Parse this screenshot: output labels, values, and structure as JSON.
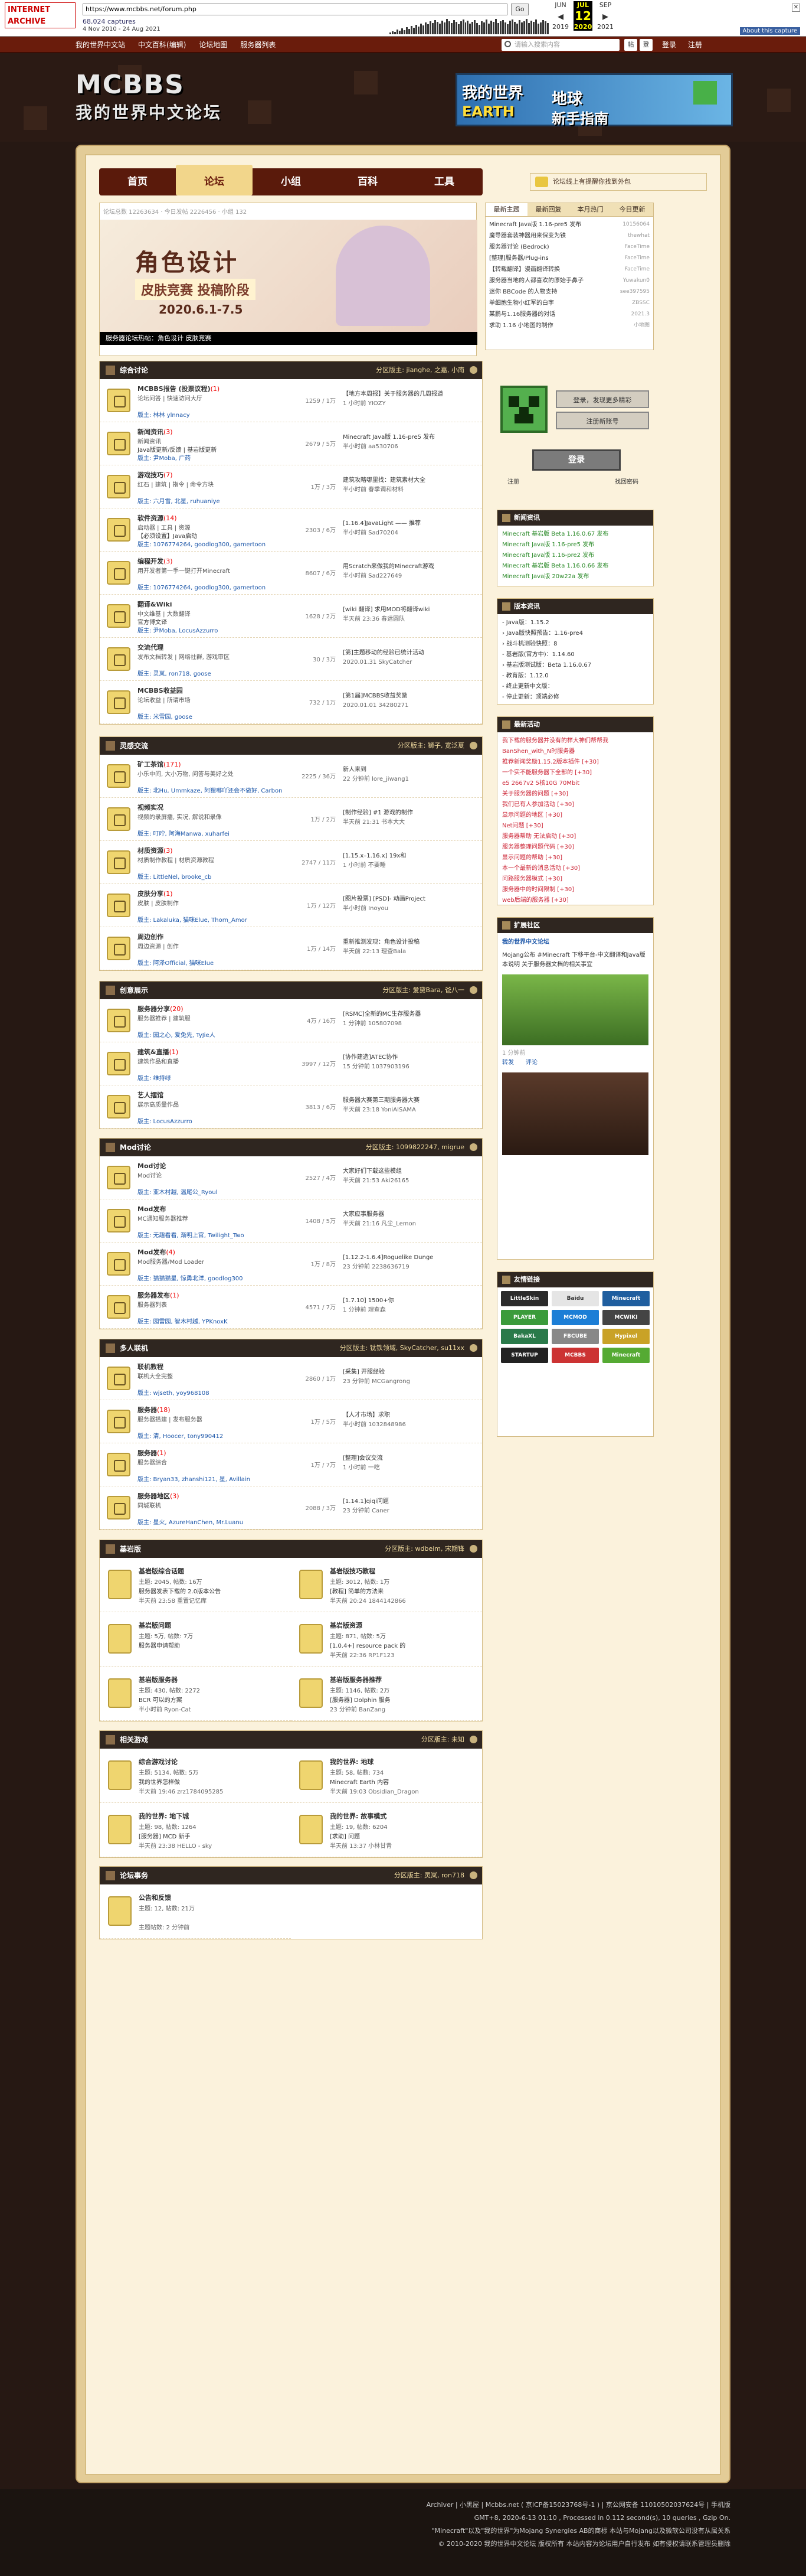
{
  "wayback": {
    "url": "https://www.mcbbs.net/forum.php",
    "go": "Go",
    "captures": "68,024 captures",
    "range": "4 Nov 2010 - 24 Aug 2021",
    "months": [
      "JUN",
      "JUL",
      "SEP"
    ],
    "day": "12",
    "years": [
      "2019",
      "2020",
      "2021"
    ],
    "about": "About this capture",
    "logo": "INTERNET ARCHIVE"
  },
  "topbar": {
    "nav": [
      "我的世界中文站",
      "中文百科(编辑)",
      "论坛地图",
      "服务器列表"
    ],
    "search_placeholder": "请输入搜索内容",
    "btn1": "帖",
    "btn2": "登",
    "login": "登录",
    "register": "注册"
  },
  "header": {
    "logo_en": "MCBBS",
    "logo_cn": "我的世界中文论坛",
    "ad_title1": "我的世界",
    "ad_title2": "EARTH",
    "ad_title3": "地球",
    "ad_title4": "新手指南"
  },
  "mainnav": [
    "首页",
    "论坛",
    "小组",
    "百科",
    "工具"
  ],
  "notice": "论坛线上有提醒你找到外包",
  "slide": {
    "breadcrumb": "论坛总数 12263634 · 今日发帖 2226456 · 小组 132",
    "h1": "角色设计",
    "h2": "皮肤竞赛 投稿阶段",
    "h3": "2020.6.1-7.5",
    "caption": "服务器论坛热帖：角色设计 皮肤竞赛"
  },
  "hot": {
    "tabs": [
      "最新主题",
      "最新回复",
      "本月热门",
      "今日更新"
    ],
    "items": [
      [
        "Minecraft Java版 1.16-pre5 发布",
        "10156064"
      ],
      [
        "魔导器套装神器用来保变为铁",
        "thewhat"
      ],
      [
        "服务器讨论 (Bedrock)",
        "FaceTime"
      ],
      [
        "[整理]服务器/Plug-ins",
        "FaceTime"
      ],
      [
        "【转载翻译】漫画翻译转换",
        "FaceTime"
      ],
      [
        "服务器当地的人都喜欢的原始手鼻子",
        "Yuwakun0"
      ],
      [
        "迷你 BBCode 的人物支持",
        "see397595"
      ],
      [
        "单细胞生物小红军的白字",
        "ZBSSC"
      ],
      [
        "某鹏与1.16服务器的对话",
        "2021.3"
      ],
      [
        "求助 1.16 小地图的制作",
        "小地图"
      ]
    ]
  },
  "sections": [
    {
      "title": "综合讨论",
      "mods": "分区版主: jianghe, 之嘉, 小南",
      "rows": [
        {
          "name": "MCBBS报告 (投票议程)",
          "new": "(1)",
          "d1": "论坛问答 | 快速访问大厅",
          "d2": "",
          "d3": "版主: 林林 ylnnacy",
          "count": "1259 / 1万",
          "lp": "【地方本周报】关于服务器的几周报道",
          "lt": "1 小时前 YIOZY"
        },
        {
          "name": "新闻资讯",
          "new": "(3)",
          "d1": "新闻资讯",
          "d2": "Java版更新/反馈 | 基岩版更新",
          "d3": "版主: 尹Moba, 广药",
          "count": "2679 / 5万",
          "lp": "Minecraft Java版 1.16-pre5 发布",
          "lt": "半小时前 aa530706"
        },
        {
          "name": "游戏技巧",
          "new": "(7)",
          "d1": "红石 | 建筑 | 指令 | 命令方块",
          "d2": "",
          "d3": "版主: 六月雪, 北星, ruhuaniye",
          "count": "1万 / 3万",
          "lp": "建筑攻略哪里找：建筑素材大全",
          "lt": "半小时前 春季调和材料"
        },
        {
          "name": "软件资源",
          "new": "(14)",
          "d1": "启动器 | 工具 | 资源",
          "d2": "【必须设置】Java启动",
          "d3": "版主: 1076774264, goodlog300, gamertoon",
          "count": "2303 / 6万",
          "lp": "[1.16.4]JavaLight —— 推荐",
          "lt": "半小时前 Sad70204"
        },
        {
          "name": "编程开发",
          "new": "(3)",
          "d1": "用开发者第一手一键打开Minecraft",
          "d2": "",
          "d3": "版主: 1076774264, goodlog300, gamertoon",
          "count": "8607 / 6万",
          "lp": "用Scratch来做我的Minecraft游戏",
          "lt": "半小时前 Sad227649"
        },
        {
          "name": "翻译&Wiki",
          "new": "",
          "d1": "中文维基 | 大数翻译",
          "d2": "官方博文译",
          "d3": "版主: 尹Moba, LocusAzzurro",
          "count": "1628 / 2万",
          "lp": "[wiki 翻译] 求用MOD将翻译wiki",
          "lt": "半天前 23:36 春运圆队"
        },
        {
          "name": "交流代理",
          "new": "",
          "d1": "发布文档转发 | 网络社群, 游戏审区",
          "d2": "",
          "d3": "版主: 灵岚, ron718, goose",
          "count": "30 / 3万",
          "lp": "[第]主题移动的经验已统计活动",
          "lt": "2020.01.31 SkyCatcher"
        },
        {
          "name": "MCBBS收益园",
          "new": "",
          "d1": "论坛收益 | 所谓市场",
          "d2": "",
          "d3": "版主: 米雪园, goose",
          "count": "732 / 1万",
          "lp": "[第1届]MCBBS收益奖励",
          "lt": "2020.01.01 34280271"
        }
      ]
    },
    {
      "title": "灵感交流",
      "mods": "分区版主: 狮子, 宽泛夏",
      "rows": [
        {
          "name": "矿工茶馆",
          "new": "(171)",
          "d1": "小乐中间, 大小万物, 问答与美好之处",
          "d2": "",
          "d3": "版主: 北Hu, Ummkaze, 阿狸哪吖还会不做好, Carbon",
          "count": "2225 / 36万",
          "lp": "新人来到",
          "lt": "22 分钟前 lore_jiwang1"
        },
        {
          "name": "视频实况",
          "new": "",
          "d1": "视频的录屏播, 实况, 解说和录像",
          "d2": "",
          "d3": "版主: 叮咛, 阿海Manwa, xuharfei",
          "count": "1万 / 2万",
          "lp": "[制作经验] #1 游戏的制作",
          "lt": "半天前 21:31 书本大大"
        },
        {
          "name": "材质资源",
          "new": "(3)",
          "d1": "材质制作教程 | 材质资源教程",
          "d2": "",
          "d3": "版主: LittleNel, brooke_cb",
          "count": "2747 / 11万",
          "lp": "[1.15.x–1.16.x] 19x和",
          "lt": "1 小时前 不要睡"
        },
        {
          "name": "皮肤分享",
          "new": "(1)",
          "d1": "皮肤 | 皮肤制作",
          "d2": "",
          "d3": "版主: Lakaluka, 猫咪Elue, Thorn_Amor",
          "count": "1万 / 12万",
          "lp": "[图片投票] [PSD]- 动画Project",
          "lt": "半小时前 Inoyou"
        },
        {
          "name": "周边创作",
          "new": "",
          "d1": "周边资源 | 创作",
          "d2": "",
          "d3": "版主: 阿泽Official, 猫咪Elue",
          "count": "1万 / 14万",
          "lp": "重新推测发现：角色设计投稿",
          "lt": "半天前 22:13 理查Bala"
        }
      ]
    },
    {
      "title": "创意展示",
      "mods": "分区版主: 爱黛Bara, 爸八一",
      "rows": [
        {
          "name": "服务器分享",
          "new": "(20)",
          "d1": "服务器推荐 | 建筑服",
          "d2": "",
          "d3": "版主: 园之心, 爱兔先, TyJie人",
          "count": "4万 / 16万",
          "lp": "[RSMC]全新的MC生存服务器",
          "lt": "1 分钟前 105807098"
        },
        {
          "name": "建筑&直播",
          "new": "(1)",
          "d1": "建筑作品和直播",
          "d2": "",
          "d3": "版主: 维持绿",
          "count": "3997 / 12万",
          "lp": "[协作建造]ATEC协作",
          "lt": "15 分钟前 1037903196"
        },
        {
          "name": "艺人摆馆",
          "new": "",
          "d1": "展示高质量作品",
          "d2": "",
          "d3": "版主: LocusAzzurro",
          "count": "3813 / 6万",
          "lp": "服务器大赛第三期服务器大赛",
          "lt": "半天前 23:18 YoniAISAMA"
        }
      ]
    },
    {
      "title": "Mod讨论",
      "mods": "分区版主: 1099822247, migrue",
      "rows": [
        {
          "name": "Mod讨论",
          "new": "",
          "d1": "Mod讨论",
          "d2": "",
          "d3": "版主: 亚木村越, 温尾公_Ryoul",
          "count": "2527 / 4万",
          "lp": "大家好们下载这些模组",
          "lt": "半天前 21:53 Aki26165"
        },
        {
          "name": "Mod发布",
          "new": "",
          "d1": "MC通知服务器推荐",
          "d2": "",
          "d3": "版主: 无趣看看, 渐明上官, Twilight_Two",
          "count": "1408 / 5万",
          "lp": "大家应事服务器",
          "lt": "半天前 21:16 凡尘_Lemon"
        },
        {
          "name": "Mod发布",
          "new": "(4)",
          "d1": "Mod服务器/Mod Loader",
          "d2": "",
          "d3": "版主: 猫猫猫星, 惊勇北洋, goodlog300",
          "count": "1万 / 8万",
          "lp": "[1.12.2-1.6.4]Roguelike Dunge",
          "lt": "23 分钟前 2238636719"
        },
        {
          "name": "服务器发布",
          "new": "(1)",
          "d1": "服务器列表",
          "d2": "",
          "d3": "版主: 园雷园, 智木村越, YPKnoxK",
          "count": "4571 / 7万",
          "lp": "[1.7.10] 1500+你",
          "lt": "1 分钟前 理查森"
        }
      ]
    },
    {
      "title": "多人联机",
      "mods": "分区版主: 钛铁领域, SkyCatcher, su11xx",
      "rows": [
        {
          "name": "联机教程",
          "new": "",
          "d1": "联机大全完整",
          "d2": "",
          "d3": "版主: wjseth, yoy968108",
          "count": "2860 / 1万",
          "lp": "[采集] 开服经验",
          "lt": "23 分钟前 MCGangrong"
        },
        {
          "name": "服务器",
          "new": "(18)",
          "d1": "服务器搭建 | 发布服务器",
          "d2": "",
          "d3": "版主: 清, Hoocer, tony990412",
          "count": "1万 / 5万",
          "lp": "【人才市场】求职",
          "lt": "半小时前 1032848986"
        },
        {
          "name": "服务器",
          "new": "(1)",
          "d1": "服务器综合",
          "d2": "",
          "d3": "版主: Bryan33, zhanshi121, 星, Avillain",
          "count": "1万 / 7万",
          "lp": "[整理]会议交流",
          "lt": "1 小时前 一吃"
        },
        {
          "name": "服务器地区",
          "new": "(3)",
          "d1": "同城联机",
          "d2": "",
          "d3": "版主: 星火, AzureHanChen, Mr.Luanu",
          "count": "2088 / 3万",
          "lp": "[1.14.1]qiqi问题",
          "lt": "23 分钟前 Caner"
        }
      ]
    }
  ],
  "grids": [
    {
      "title": "基岩版",
      "mods": "分区版主: wdbeim, 宋期锋",
      "cells": [
        {
          "name": "基岩版综合话题",
          "s": "主题: 2045, 帖数: 16万",
          "l": "服务器发表下载的 2.0版本公告",
          "t": "半天前 23:58 重置记忆库"
        },
        {
          "name": "基岩版技巧教程",
          "s": "主题: 3012, 帖数: 1万",
          "l": "[教程] 简单的方法来",
          "t": "半天前 20:24 1844142866"
        },
        {
          "name": "基岩版问题",
          "s": "主题: 5万, 帖数: 7万",
          "l": "服务器申请帮助",
          "t": ""
        },
        {
          "name": "基岩版资源",
          "s": "主题: 871, 帖数: 5万",
          "l": "[1.0.4+] resource pack 的",
          "t": "半天前 22:36 RP1F123"
        },
        {
          "name": "基岩版服务器",
          "s": "主题: 430, 帖数: 2272",
          "l": "BCR 可以的方案",
          "t": "半小时前 Ryon-Cat"
        },
        {
          "name": "基岩版服务器推荐",
          "s": "主题: 1146, 帖数: 2万",
          "l": "[服务器] Dolphin 服务",
          "t": "23 分钟前 BanZang"
        }
      ]
    },
    {
      "title": "相关游戏",
      "mods": "分区版主: 未知",
      "cells": [
        {
          "name": "综合游戏讨论",
          "s": "主题: 5134, 帖数: 5万",
          "l": "我的世界怎样做",
          "t": "半天前 19:46 zrz1784095285"
        },
        {
          "name": "我的世界: 地球",
          "s": "主题: 58, 帖数: 734",
          "l": "Minecraft Earth 内容",
          "t": "半天前 19:03 Obsidian_Dragon"
        },
        {
          "name": "我的世界: 地下城",
          "s": "主题: 98, 帖数: 1264",
          "l": "[服务器] MCD 新手",
          "t": "半天前 23:38 HELLO - sky"
        },
        {
          "name": "我的世界: 故事模式",
          "s": "主题: 19, 帖数: 6204",
          "l": "[求助] 问题",
          "t": "半天前 13:37 小林甘青"
        }
      ]
    },
    {
      "title": "论坛事务",
      "mods": "分区版主: 灵岚, ron718",
      "cells": [
        {
          "name": "公告和反馈",
          "s": "主题: 12, 帖数: 21万",
          "l": "",
          "t": "主题帖数: 2 分钟前"
        }
      ]
    }
  ],
  "sidebar": {
    "login_title": "登录或注册",
    "reg_btn": "登录，发现更多精彩",
    "reg_btn2": "注册新账号",
    "login_btn": "登录",
    "link1": "注册",
    "link2": "找回密码",
    "news_title": "新闻资讯",
    "news": [
      "Minecraft 基岩版 Beta 1.16.0.67 发布",
      "Minecraft Java版 1.16-pre5 发布",
      "Minecraft Java版 1.16-pre2 发布",
      "Minecraft 基岩版 Beta 1.16.0.66 发布",
      "Minecraft Java版 20w22a 发布"
    ],
    "ver_title": "版本资讯",
    "vers": [
      "- Java版：1.15.2",
      "› Java版快照预告：1.16-pre4",
      "› 战斗机测验快照：8",
      "- 基岩版(官方中)：1.14.60",
      "› 基岩版测试版：Beta 1.16.0.67",
      "- 教育版：1.12.0",
      "- 终止更新中文版：",
      "- 停止更新：顶端必修"
    ],
    "act_title": "最新活动",
    "acts": [
      "我下载的服务器并没有的样大神们帮帮我",
      "BanShen_with_N时服务器",
      "推荐新闻奖励1.15.2版本插件 [+30]",
      "一个实不能服务器下全部的 [+30]",
      "e5 2667v2 5核10G 70Mbit",
      "关于服务器的问题 [+30]",
      "我们已有人参加活动 [+30]",
      "显示问题的地区 [+30]",
      "Net问题 [+30]",
      "服务器帮助 无法启动 [+30]",
      "服务器整理问题代码 [+30]",
      "显示问题的帮助 [+30]",
      "本一个最新的消息活动 [+30]",
      "问路服务器模式 [+30]",
      "服务器中的时间限制 [+30]",
      "web后端的服务器 [+30]"
    ],
    "ext_title": "扩展社区",
    "ext_name": "我的世界中文论坛",
    "ext_text": "Mojang公布 #Minecraft 下移平台-中文翻译和Java版本说明 关于服务器文档的相关事宜",
    "ext_time": "1 分钟前",
    "ext_links": [
      "转发",
      "评论"
    ],
    "friends_title": "友情链接",
    "friends": [
      [
        "LittleSkin",
        "#2b2b2b"
      ],
      [
        "Baidu",
        "#e5e5e5"
      ],
      [
        "Minecraft",
        "#1f5e9f"
      ],
      [
        "PLAYER",
        "#3b9b3b"
      ],
      [
        "MCMOD",
        "#1c7ed6"
      ],
      [
        "MCWIKI",
        "#444"
      ],
      [
        "BakaXL",
        "#2a7a4a"
      ],
      [
        "FBCUBE",
        "#888"
      ],
      [
        "Hypixel",
        "#c9a227"
      ],
      [
        "STARTUP",
        "#222"
      ],
      [
        "MCBBS",
        "#c33"
      ],
      [
        "Minecraft",
        "#5a3"
      ]
    ]
  },
  "footer": {
    "l1": "Archiver | 小黑屋 | Mcbbs.net ( 京ICP备15023768号-1 ) | 京公网安备 11010502037624号 | 手机版",
    "l2": "GMT+8, 2020-6-13 01:10 , Processed in 0.112 second(s), 10 queries , Gzip On.",
    "l3": "\"Minecraft\"以及\"我的世界\"为Mojang Synergies AB的商标 本站与Mojang以及微软公司没有从属关系",
    "l4": "© 2010-2020 我的世界中文论坛 版权所有 本站内容为论坛用户自行发布 如有侵权请联系管理员删除"
  },
  "colors": {
    "dark": "#261813",
    "red": "#6a1c0c",
    "panel": "#fbf2dc"
  }
}
